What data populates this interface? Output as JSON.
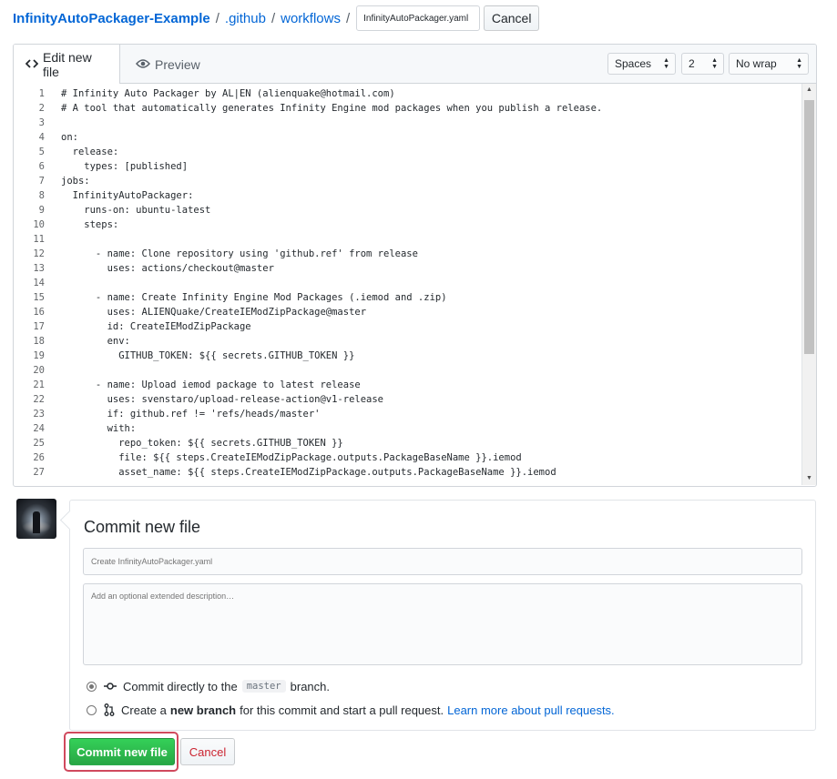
{
  "breadcrumb": {
    "repo": "InfinityAutoPackager-Example",
    "sep1": "/",
    "dir1": ".github",
    "sep2": "/",
    "dir2": "workflows",
    "sep3": "/",
    "filename_value": "InfinityAutoPackager.yaml",
    "cancel_label": "Cancel"
  },
  "editor": {
    "tabs": [
      {
        "label": "Edit new file",
        "icon": "code-icon",
        "active": true
      },
      {
        "label": "Preview",
        "icon": "eye-icon",
        "active": false
      }
    ],
    "indent_mode": "Spaces",
    "indent_size": "2",
    "wrap_mode": "No wrap",
    "lines": [
      {
        "n": "1",
        "t": "# Infinity Auto Packager by AL|EN (alienquake@hotmail.com)"
      },
      {
        "n": "2",
        "t": "# A tool that automatically generates Infinity Engine mod packages when you publish a release."
      },
      {
        "n": "3",
        "t": ""
      },
      {
        "n": "4",
        "t": "on:"
      },
      {
        "n": "5",
        "t": "  release:"
      },
      {
        "n": "6",
        "t": "    types: [published]"
      },
      {
        "n": "7",
        "t": "jobs:"
      },
      {
        "n": "8",
        "t": "  InfinityAutoPackager:"
      },
      {
        "n": "9",
        "t": "    runs-on: ubuntu-latest"
      },
      {
        "n": "10",
        "t": "    steps:"
      },
      {
        "n": "11",
        "t": ""
      },
      {
        "n": "12",
        "t": "      - name: Clone repository using 'github.ref' from release"
      },
      {
        "n": "13",
        "t": "        uses: actions/checkout@master"
      },
      {
        "n": "14",
        "t": ""
      },
      {
        "n": "15",
        "t": "      - name: Create Infinity Engine Mod Packages (.iemod and .zip)"
      },
      {
        "n": "16",
        "t": "        uses: ALIENQuake/CreateIEModZipPackage@master"
      },
      {
        "n": "17",
        "t": "        id: CreateIEModZipPackage"
      },
      {
        "n": "18",
        "t": "        env:"
      },
      {
        "n": "19",
        "t": "          GITHUB_TOKEN: ${{ secrets.GITHUB_TOKEN }}"
      },
      {
        "n": "20",
        "t": ""
      },
      {
        "n": "21",
        "t": "      - name: Upload iemod package to latest release"
      },
      {
        "n": "22",
        "t": "        uses: svenstaro/upload-release-action@v1-release"
      },
      {
        "n": "23",
        "t": "        if: github.ref != 'refs/heads/master'"
      },
      {
        "n": "24",
        "t": "        with:"
      },
      {
        "n": "25",
        "t": "          repo_token: ${{ secrets.GITHUB_TOKEN }}"
      },
      {
        "n": "26",
        "t": "          file: ${{ steps.CreateIEModZipPackage.outputs.PackageBaseName }}.iemod"
      },
      {
        "n": "27",
        "t": "          asset_name: ${{ steps.CreateIEModZipPackage.outputs.PackageBaseName }}.iemod"
      }
    ]
  },
  "commit": {
    "title": "Commit new file",
    "summary_placeholder": "Create InfinityAutoPackager.yaml",
    "description_placeholder": "Add an optional extended description…",
    "option_direct": {
      "prefix": "Commit directly to the",
      "branch": "master",
      "suffix": "branch.",
      "checked": true
    },
    "option_new_branch": {
      "prefix": "Create a",
      "bold": "new branch",
      "suffix": "for this commit and start a pull request.",
      "link": "Learn more about pull requests.",
      "checked": false
    },
    "commit_button": "Commit new file",
    "cancel_button": "Cancel"
  },
  "colors": {
    "link": "#0366d6",
    "primary_button": "#28a745",
    "cancel_text": "#cb2431",
    "highlight_border": "#d0495d"
  }
}
